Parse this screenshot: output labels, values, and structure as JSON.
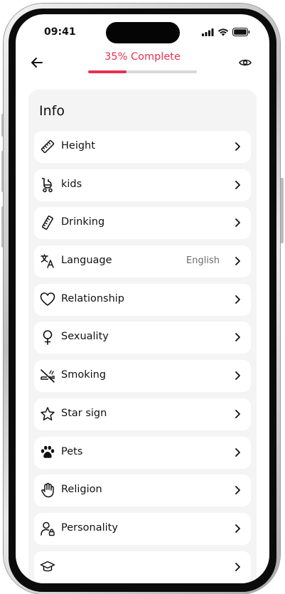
{
  "status_bar": {
    "time": "09:41"
  },
  "header": {
    "progress_label": "35% Complete",
    "progress_fraction": 0.35
  },
  "info": {
    "title": "Info",
    "items": [
      {
        "label": "Height",
        "value": "",
        "icon": "ruler-icon"
      },
      {
        "label": "kids",
        "value": "",
        "icon": "stroller-icon"
      },
      {
        "label": "Drinking",
        "value": "",
        "icon": "ruler-icon"
      },
      {
        "label": "Language",
        "value": "English",
        "icon": "translate-icon"
      },
      {
        "label": "Relationship",
        "value": "",
        "icon": "heart-icon"
      },
      {
        "label": "Sexuality",
        "value": "",
        "icon": "female-icon"
      },
      {
        "label": "Smoking",
        "value": "",
        "icon": "no-smoking-icon"
      },
      {
        "label": "Star sign",
        "value": "",
        "icon": "star-icon"
      },
      {
        "label": "Pets",
        "value": "",
        "icon": "paw-icon"
      },
      {
        "label": "Religion",
        "value": "",
        "icon": "hand-icon"
      },
      {
        "label": "Personality",
        "value": "",
        "icon": "person-icon"
      },
      {
        "label": "",
        "value": "",
        "icon": "graduation-cap-icon"
      }
    ]
  },
  "colors": {
    "accent": "#e8304f",
    "card_bg": "#f4f4f4",
    "row_bg": "#ffffff"
  }
}
